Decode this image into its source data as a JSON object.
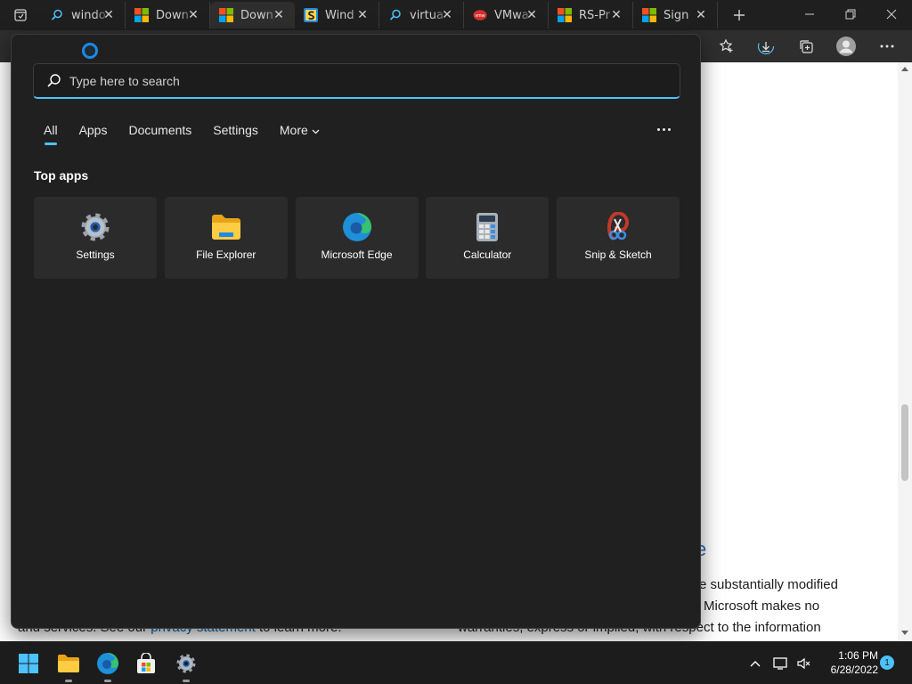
{
  "browser": {
    "tabs": [
      {
        "title": "windo",
        "icon": "search-icon"
      },
      {
        "title": "Down",
        "icon": "microsoft-logo-icon"
      },
      {
        "title": "Down",
        "icon": "microsoft-logo-icon"
      },
      {
        "title": "Wind",
        "icon": "s-icon"
      },
      {
        "title": "virtua",
        "icon": "search-icon"
      },
      {
        "title": "VMwa",
        "icon": "vmware-icon"
      },
      {
        "title": "RS-Pr",
        "icon": "microsoft-logo-icon"
      },
      {
        "title": "Sign",
        "icon": "microsoft-logo-icon"
      }
    ],
    "active_tab_index": 2
  },
  "search": {
    "placeholder": "Type here to search",
    "filters": [
      "All",
      "Apps",
      "Documents",
      "Settings",
      "More"
    ],
    "active_filter": "All",
    "top_apps_heading": "Top apps",
    "apps": [
      {
        "label": "Settings",
        "icon": "gear-icon"
      },
      {
        "label": "File Explorer",
        "icon": "folder-icon"
      },
      {
        "label": "Microsoft Edge",
        "icon": "edge-icon"
      },
      {
        "label": "Calculator",
        "icon": "calculator-icon"
      },
      {
        "label": "Snip & Sketch",
        "icon": "snip-sketch-icon"
      }
    ]
  },
  "webpage": {
    "fragment_e": "e",
    "line1": "e substantially modified",
    "line2": "Microsoft makes no",
    "line3_left_a": "and services. See our",
    "line3_left_link": "privacy statement",
    "line3_left_b": "to learn more.",
    "line3_right": "warranties, express or implied, with respect to the information"
  },
  "taskbar": {
    "time": "1:06 PM",
    "date": "6/28/2022",
    "notification_count": "1"
  },
  "colors": {
    "accent": "#4cc2ff",
    "flyout_bg": "#202020",
    "tile_bg": "#2b2b2b",
    "taskbar_bg": "#1c1c1c",
    "link": "#0067b8"
  }
}
